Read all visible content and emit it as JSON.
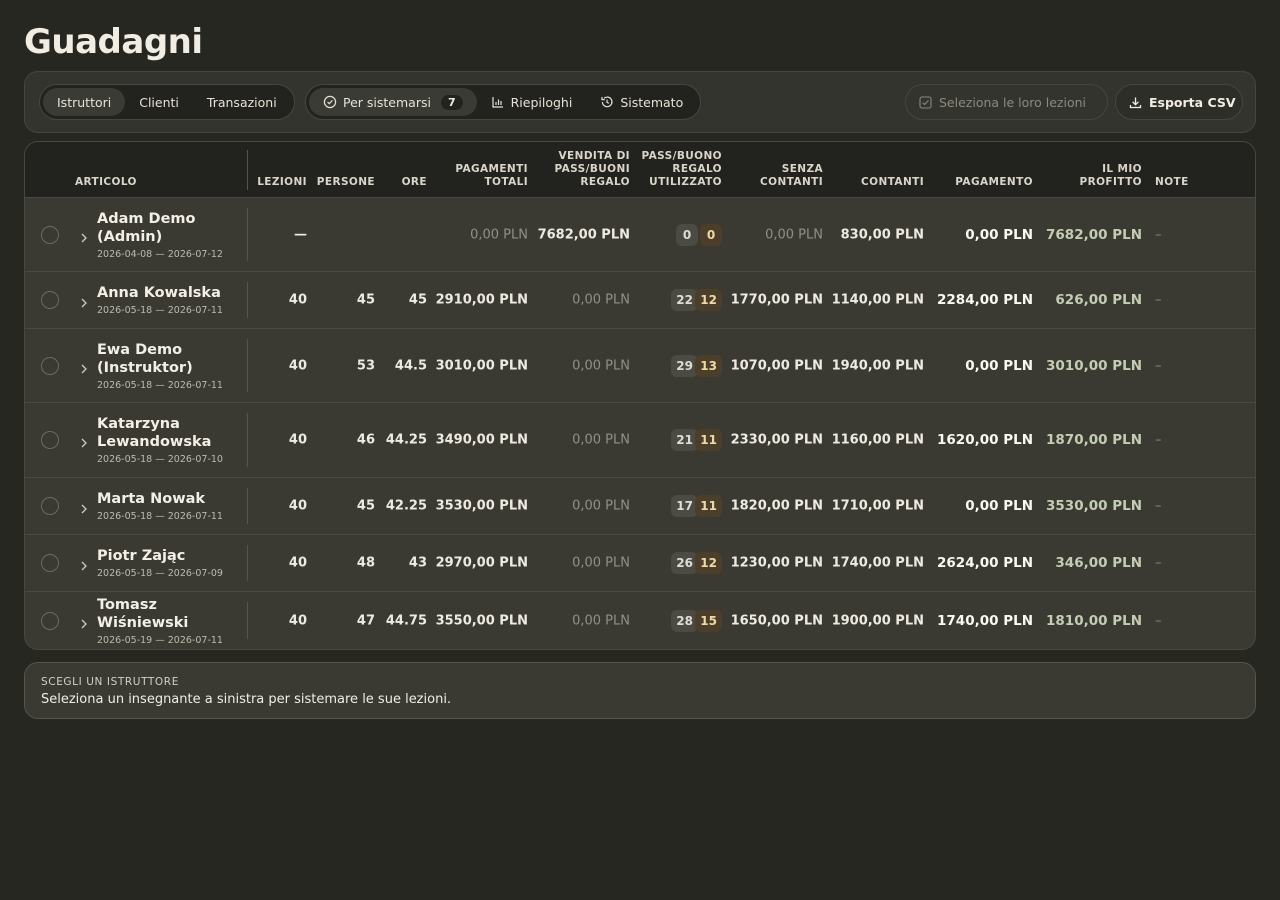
{
  "page": {
    "title": "Guadagni"
  },
  "toolbar": {
    "views": [
      {
        "label": "Istruttori",
        "active": true
      },
      {
        "label": "Clienti",
        "active": false
      },
      {
        "label": "Transazioni",
        "active": false
      }
    ],
    "filters": {
      "to_settle": {
        "label": "Per sistemarsi",
        "count": "7",
        "icon": "check-circle-icon"
      },
      "summaries": {
        "label": "Riepiloghi",
        "icon": "bar-chart-icon"
      },
      "settled": {
        "label": "Sistemato",
        "icon": "history-icon"
      }
    },
    "select_lessons": {
      "label": "Seleziona le loro lezioni",
      "icon": "checkbox-icon",
      "disabled": true
    },
    "export": {
      "label": "Esporta CSV",
      "icon": "download-icon"
    }
  },
  "table": {
    "headers": {
      "article": "ARTICOLO",
      "lessons": "LEZIONI",
      "people": "PERSONE",
      "hours": "ORE",
      "total_payments": [
        "PAGAMENTI",
        "TOTALI"
      ],
      "pass_sales": [
        "VENDITA DI",
        "PASS/BUONI",
        "REGALO"
      ],
      "pass_used": [
        "PASS/BUONO",
        "REGALO",
        "UTILIZZATO"
      ],
      "cashless": [
        "SENZA",
        "CONTANTI"
      ],
      "cash": "CONTANTI",
      "payment": "PAGAMENTO",
      "my_profit": [
        "IL MIO",
        "PROFITTO"
      ],
      "notes": "NOTE"
    },
    "rows": [
      {
        "name": [
          "Adam Demo",
          "(Admin)"
        ],
        "dates": "2026-04-08 — 2026-07-12",
        "lessons": "—",
        "people": "",
        "hours": "",
        "total": "0,00 PLN",
        "pass_sales": "7682,00 PLN",
        "used_a": "0",
        "used_b": "0",
        "cashless": "0,00 PLN",
        "cash": "830,00 PLN",
        "payment": "0,00 PLN",
        "profit": "7682,00 PLN",
        "note": "–",
        "muted_total": true,
        "muted_sales": false,
        "muted_cashless": true
      },
      {
        "name": [
          "Anna Kowalska"
        ],
        "dates": "2026-05-18 — 2026-07-11",
        "lessons": "40",
        "people": "45",
        "hours": "45",
        "total": "2910,00 PLN",
        "pass_sales": "0,00 PLN",
        "used_a": "22",
        "used_b": "12",
        "cashless": "1770,00 PLN",
        "cash": "1140,00 PLN",
        "payment": "2284,00 PLN",
        "profit": "626,00 PLN",
        "note": "–",
        "muted_total": false,
        "muted_sales": true,
        "muted_cashless": false
      },
      {
        "name": [
          "Ewa Demo",
          "(Instruktor)"
        ],
        "dates": "2026-05-18 — 2026-07-11",
        "lessons": "40",
        "people": "53",
        "hours": "44.5",
        "total": "3010,00 PLN",
        "pass_sales": "0,00 PLN",
        "used_a": "29",
        "used_b": "13",
        "cashless": "1070,00 PLN",
        "cash": "1940,00 PLN",
        "payment": "0,00 PLN",
        "profit": "3010,00 PLN",
        "note": "–",
        "muted_total": false,
        "muted_sales": true,
        "muted_cashless": false
      },
      {
        "name": [
          "Katarzyna",
          "Lewandowska"
        ],
        "dates": "2026-05-18 — 2026-07-10",
        "lessons": "40",
        "people": "46",
        "hours": "44.25",
        "total": "3490,00 PLN",
        "pass_sales": "0,00 PLN",
        "used_a": "21",
        "used_b": "11",
        "cashless": "2330,00 PLN",
        "cash": "1160,00 PLN",
        "payment": "1620,00 PLN",
        "profit": "1870,00 PLN",
        "note": "–",
        "muted_total": false,
        "muted_sales": true,
        "muted_cashless": false
      },
      {
        "name": [
          "Marta Nowak"
        ],
        "dates": "2026-05-18 — 2026-07-11",
        "lessons": "40",
        "people": "45",
        "hours": "42.25",
        "total": "3530,00 PLN",
        "pass_sales": "0,00 PLN",
        "used_a": "17",
        "used_b": "11",
        "cashless": "1820,00 PLN",
        "cash": "1710,00 PLN",
        "payment": "0,00 PLN",
        "profit": "3530,00 PLN",
        "note": "–",
        "muted_total": false,
        "muted_sales": true,
        "muted_cashless": false
      },
      {
        "name": [
          "Piotr Zając"
        ],
        "dates": "2026-05-18 — 2026-07-09",
        "lessons": "40",
        "people": "48",
        "hours": "43",
        "total": "2970,00 PLN",
        "pass_sales": "0,00 PLN",
        "used_a": "26",
        "used_b": "12",
        "cashless": "1230,00 PLN",
        "cash": "1740,00 PLN",
        "payment": "2624,00 PLN",
        "profit": "346,00 PLN",
        "note": "–",
        "muted_total": false,
        "muted_sales": true,
        "muted_cashless": false
      },
      {
        "name": [
          "Tomasz Wiśniewski"
        ],
        "dates": "2026-05-19 — 2026-07-11",
        "lessons": "40",
        "people": "47",
        "hours": "44.75",
        "total": "3550,00 PLN",
        "pass_sales": "0,00 PLN",
        "used_a": "28",
        "used_b": "15",
        "cashless": "1650,00 PLN",
        "cash": "1900,00 PLN",
        "payment": "1740,00 PLN",
        "profit": "1810,00 PLN",
        "note": "–",
        "muted_total": false,
        "muted_sales": true,
        "muted_cashless": false
      }
    ]
  },
  "info": {
    "title": "SCEGLI UN ISTRUTTORE",
    "text": "Seleziona un insegnante a sinistra per sistemare le sue lezioni."
  }
}
